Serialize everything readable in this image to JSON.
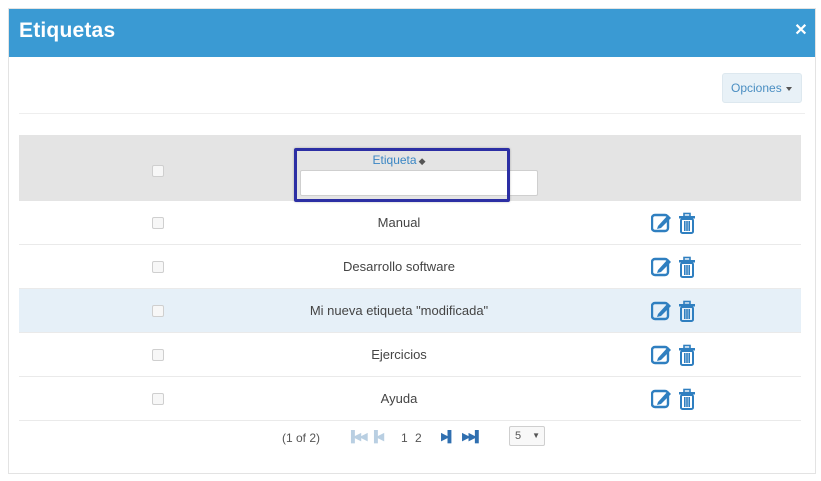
{
  "dialog": {
    "title": "Etiquetas",
    "close_icon": "close-icon"
  },
  "toolbar": {
    "options_label": "Opciones"
  },
  "table": {
    "column_header": "Etiqueta",
    "filter_value": "",
    "rows": [
      {
        "label": "Manual",
        "selected": false
      },
      {
        "label": "Desarrollo software",
        "selected": false
      },
      {
        "label": "Mi nueva etiqueta \"modificada\"",
        "selected": true
      },
      {
        "label": "Ejercicios",
        "selected": false
      },
      {
        "label": "Ayuda",
        "selected": false
      }
    ]
  },
  "pagination": {
    "info": "(1 of 2)",
    "pages": [
      "1",
      "2"
    ],
    "page_size": "5"
  },
  "colors": {
    "titlebar": "#3a9ad3",
    "accent": "#3a86c4",
    "highlight": "#2c2fa4"
  }
}
